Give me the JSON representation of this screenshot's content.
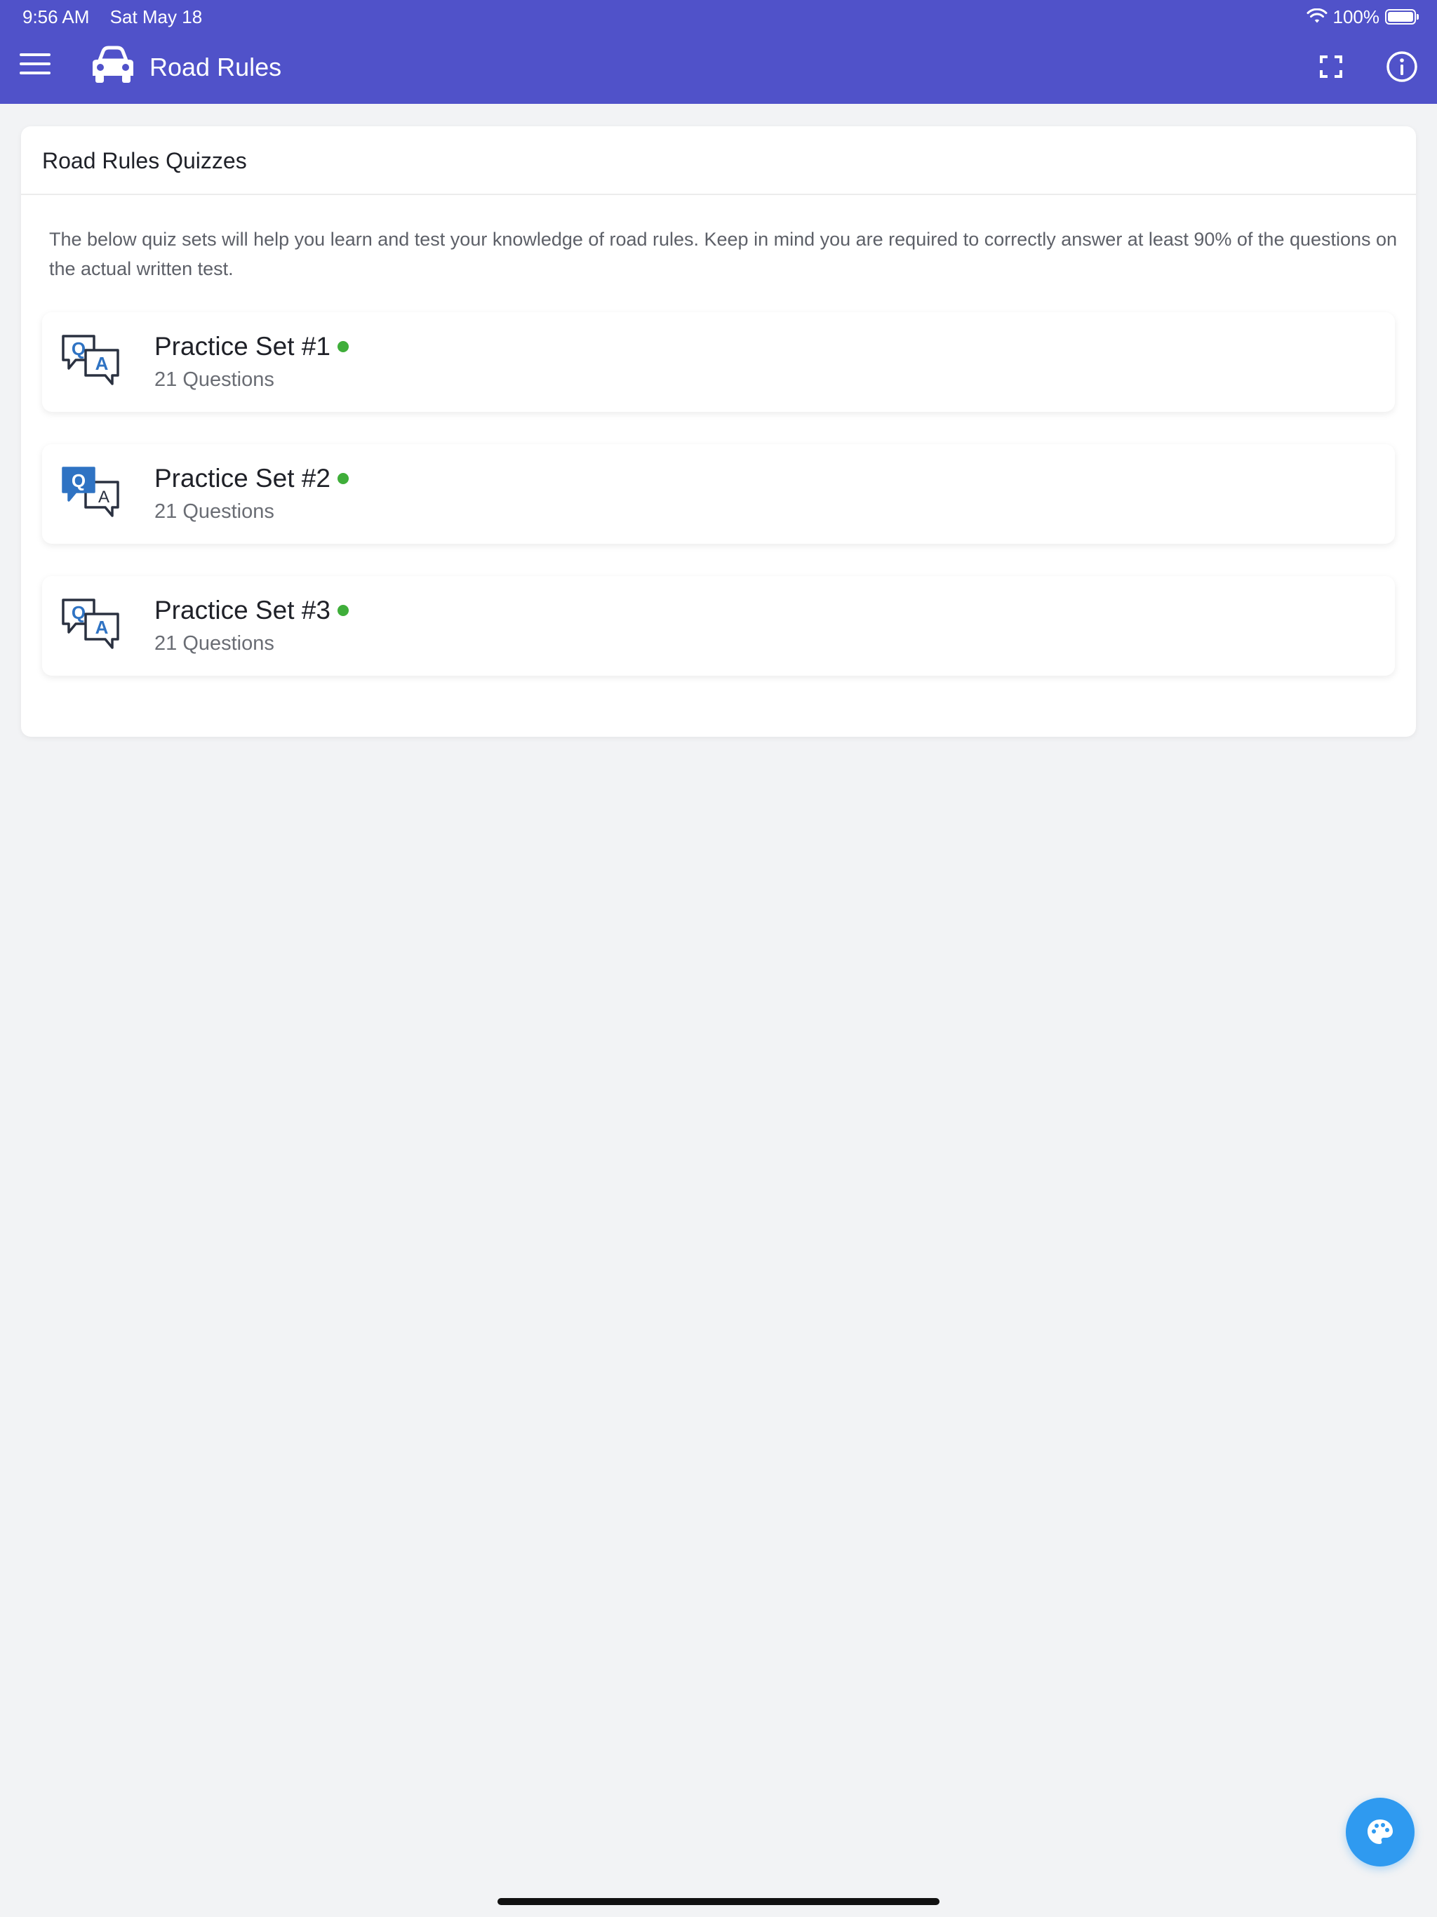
{
  "status_bar": {
    "time": "9:56 AM",
    "date": "Sat May 18",
    "battery": "100%"
  },
  "header": {
    "title": "Road Rules",
    "accent_color": "#5052c9"
  },
  "card": {
    "title": "Road Rules Quizzes",
    "description": "The below quiz sets will help you learn and test your knowledge of road rules. Keep in mind you are required to correctly answer at least 90% of the questions on the actual written test."
  },
  "practice_sets": [
    {
      "title": "Practice Set #1",
      "subtitle": "21 Questions",
      "status_color": "#3fae3a"
    },
    {
      "title": "Practice Set #2",
      "subtitle": "21 Questions",
      "status_color": "#3fae3a"
    },
    {
      "title": "Practice Set #3",
      "subtitle": "21 Questions",
      "status_color": "#3fae3a"
    }
  ],
  "icons": {
    "menu": "hamburger-menu-icon",
    "logo": "car-icon",
    "expand": "fullscreen-icon",
    "info": "info-icon",
    "set": "question-answer-icon",
    "fab": "palette-icon"
  }
}
